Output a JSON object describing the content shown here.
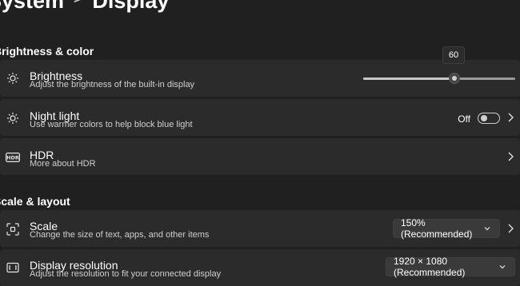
{
  "breadcrumb": {
    "parent": "System",
    "separator": ">",
    "current": "Display"
  },
  "sections": {
    "brightness_color": "Brightness & color",
    "scale_layout": "Scale & layout"
  },
  "brightness": {
    "title": "Brightness",
    "description": "Adjust the brightness of the built-in display",
    "value": "60",
    "level_percent": 60
  },
  "night_light": {
    "title": "Night light",
    "description": "Use warmer colors to help block blue light",
    "state": "Off"
  },
  "hdr": {
    "title": "HDR",
    "description": "More about HDR",
    "icon_text": "HDR"
  },
  "scale": {
    "title": "Scale",
    "description": "Change the size of text, apps, and other items",
    "selected": "150% (Recommended)"
  },
  "resolution": {
    "title": "Display resolution",
    "description": "Adjust the resolution to fit your connected display",
    "selected": "1920 × 1080 (Recommended)"
  },
  "colors": {
    "background": "#202020",
    "card": "#2b2b2b",
    "accent": "#c8c8c8"
  },
  "icons": [
    "sun-icon",
    "night-light-icon",
    "hdr-icon",
    "scale-icon",
    "resolution-icon",
    "chevron-right-icon",
    "chevron-down-icon"
  ]
}
